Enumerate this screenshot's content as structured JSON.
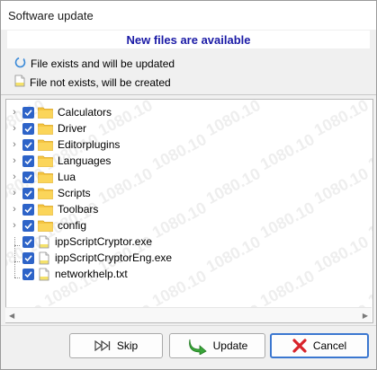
{
  "window": {
    "title": "Software update"
  },
  "header": {
    "text": "New files are available"
  },
  "legend": {
    "update_label": "File exists and will be updated",
    "create_label": "File not exists, will be created"
  },
  "tree": {
    "items": [
      {
        "label": "Calculators",
        "type": "folder",
        "checked": true
      },
      {
        "label": "Driver",
        "type": "folder",
        "checked": true
      },
      {
        "label": "Editorplugins",
        "type": "folder",
        "checked": true
      },
      {
        "label": "Languages",
        "type": "folder",
        "checked": true
      },
      {
        "label": "Lua",
        "type": "folder",
        "checked": true
      },
      {
        "label": "Scripts",
        "type": "folder",
        "checked": true
      },
      {
        "label": "Toolbars",
        "type": "folder",
        "checked": true
      },
      {
        "label": "config",
        "type": "folder",
        "checked": true
      },
      {
        "label": "ippScriptCryptor.exe",
        "type": "file",
        "checked": true
      },
      {
        "label": "ippScriptCryptorEng.exe",
        "type": "file",
        "checked": true
      },
      {
        "label": "networkhelp.txt",
        "type": "file",
        "checked": true
      }
    ],
    "watermark": "1080.10"
  },
  "buttons": {
    "skip_label": "Skip",
    "update_label": "Update",
    "cancel_label": "Cancel"
  },
  "colors": {
    "header_text": "#1a1aa6",
    "checkbox": "#2d63c8",
    "folder": "#f5c542",
    "cancel_icon": "#d8232a",
    "update_icon": "#3aa53a"
  }
}
